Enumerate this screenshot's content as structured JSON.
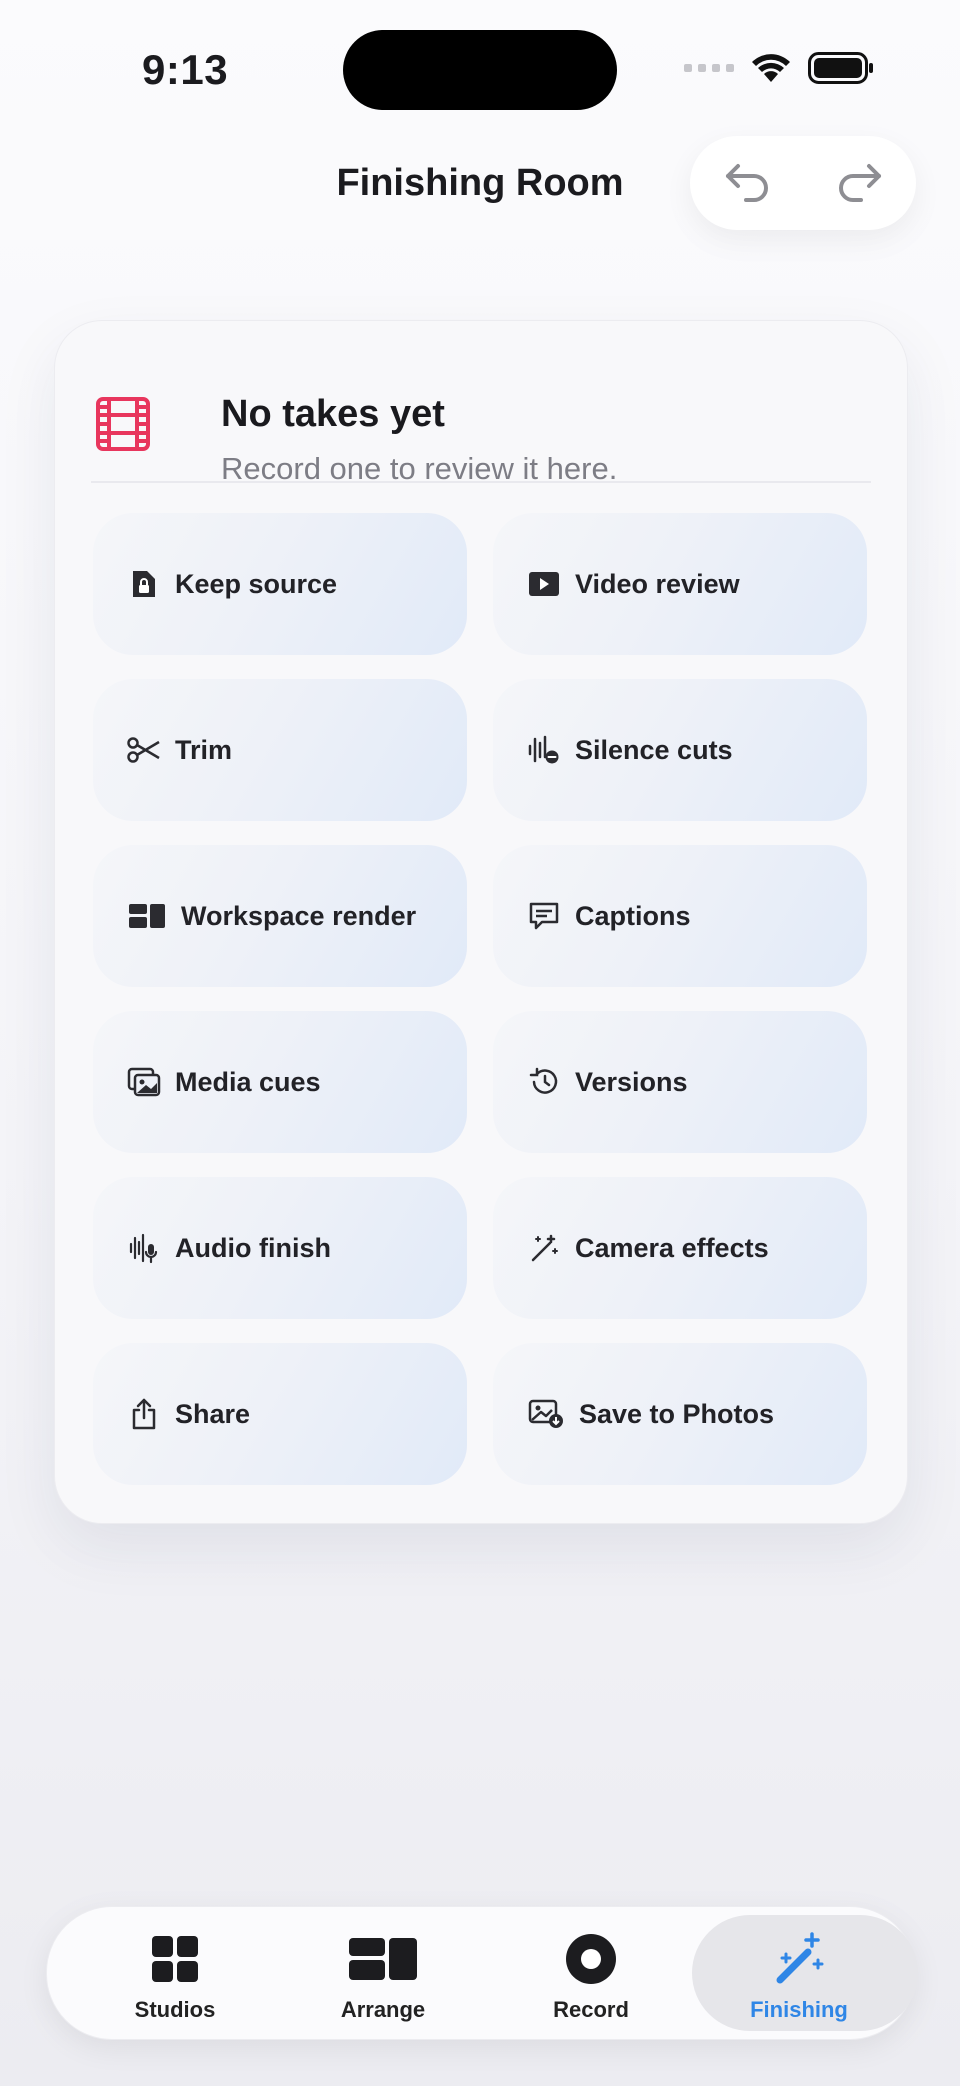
{
  "status_bar": {
    "time": "9:13"
  },
  "header": {
    "title": "Finishing Room"
  },
  "empty_state": {
    "title": "No takes yet",
    "subtitle": "Record one to review it here.",
    "accent": "#e8365d"
  },
  "actions": [
    {
      "label": "Keep source",
      "icon": "lock-document-icon"
    },
    {
      "label": "Video review",
      "icon": "play-icon"
    },
    {
      "label": "Trim",
      "icon": "scissors-icon"
    },
    {
      "label": "Silence cuts",
      "icon": "waveform-minus-icon"
    },
    {
      "label": "Workspace render",
      "icon": "layout-icon"
    },
    {
      "label": "Captions",
      "icon": "captions-icon"
    },
    {
      "label": "Media cues",
      "icon": "photo-stack-icon"
    },
    {
      "label": "Versions",
      "icon": "history-icon"
    },
    {
      "label": "Audio finish",
      "icon": "waveform-mic-icon"
    },
    {
      "label": "Camera effects",
      "icon": "magic-wand-icon"
    },
    {
      "label": "Share",
      "icon": "share-icon"
    },
    {
      "label": "Save to Photos",
      "icon": "photo-save-icon"
    }
  ],
  "tabs": [
    {
      "label": "Studios",
      "icon": "grid-icon",
      "active": false
    },
    {
      "label": "Arrange",
      "icon": "layout-icon",
      "active": false
    },
    {
      "label": "Record",
      "icon": "record-icon",
      "active": false
    },
    {
      "label": "Finishing",
      "icon": "magic-wand-icon",
      "active": true
    }
  ],
  "colors": {
    "accent": "#2f86e6",
    "empty_icon": "#e8365d"
  }
}
